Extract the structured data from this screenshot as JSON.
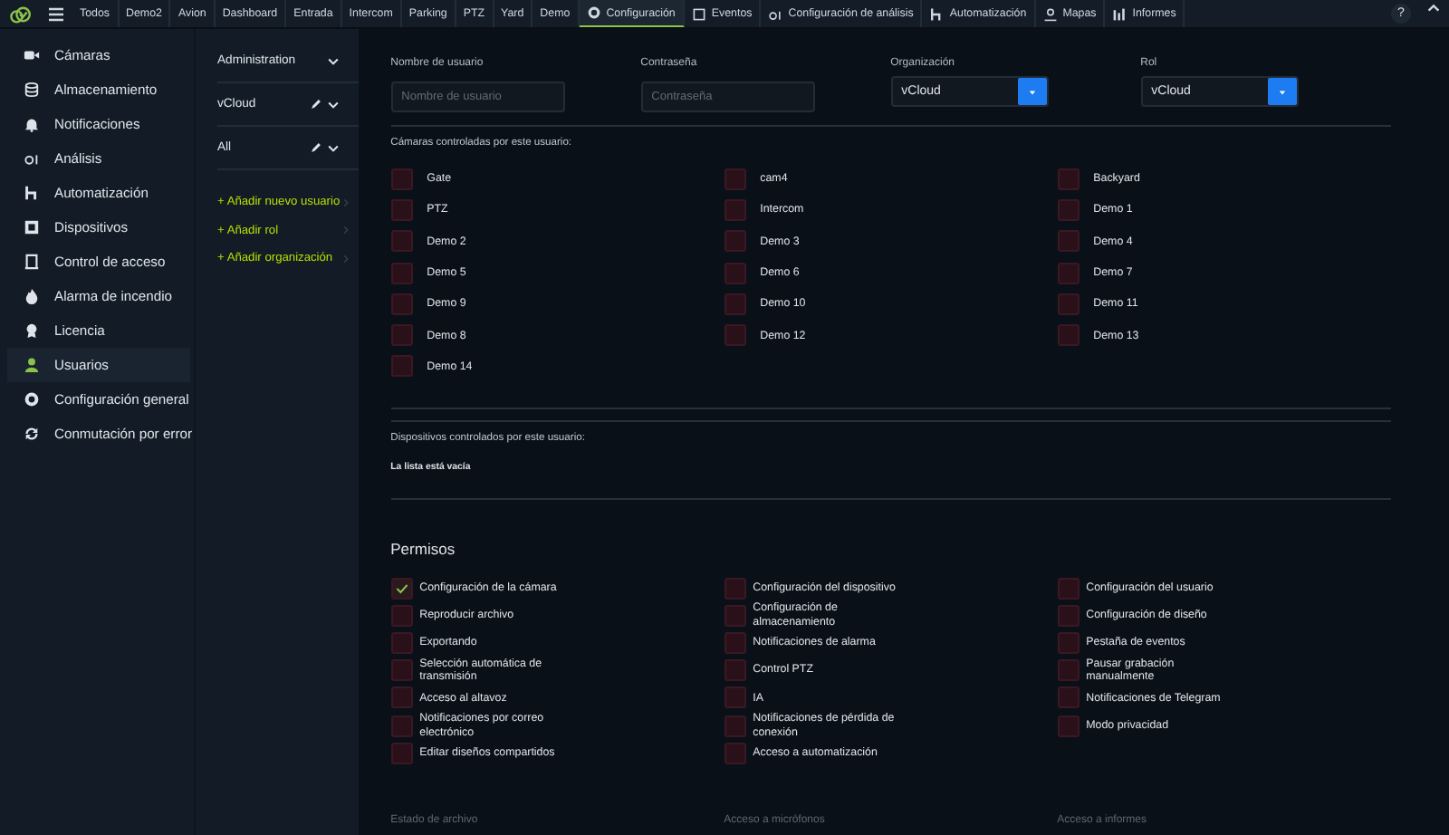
{
  "topbar": {
    "tabs": [
      {
        "label": "Todos",
        "selected": false
      },
      {
        "label": "Demo2",
        "selected": false
      },
      {
        "label": "Avion",
        "selected": false
      },
      {
        "label": "Dashboard",
        "selected": false
      },
      {
        "label": "Entrada",
        "selected": false
      },
      {
        "label": "Intercom",
        "selected": false
      },
      {
        "label": "Parking",
        "selected": false
      },
      {
        "label": "PTZ",
        "selected": false
      },
      {
        "label": "Yard",
        "selected": false
      },
      {
        "label": "Demo",
        "selected": false
      },
      {
        "label": "Configuración",
        "selected": true
      },
      {
        "label": "Eventos",
        "selected": false
      },
      {
        "label": "Configuración de análisis",
        "selected": false
      },
      {
        "label": "Automatización",
        "selected": false
      },
      {
        "label": "Mapas",
        "selected": false
      },
      {
        "label": "Informes",
        "selected": false
      }
    ],
    "help": "?"
  },
  "sidebar": {
    "items": [
      {
        "label": "Cámaras",
        "selected": false
      },
      {
        "label": "Almacenamiento",
        "selected": false
      },
      {
        "label": "Notificaciones",
        "selected": false
      },
      {
        "label": "Análisis",
        "selected": false
      },
      {
        "label": "Automatización",
        "selected": false
      },
      {
        "label": "Dispositivos",
        "selected": false
      },
      {
        "label": "Control de acceso",
        "selected": false
      },
      {
        "label": "Alarma de incendio",
        "selected": false
      },
      {
        "label": "Licencia",
        "selected": false
      },
      {
        "label": "Usuarios",
        "selected": true
      },
      {
        "label": "Configuración general",
        "selected": false
      },
      {
        "label": "Conmutación por error",
        "selected": false
      }
    ]
  },
  "tree": {
    "selectors": [
      {
        "label": "Administration",
        "editable": false
      },
      {
        "label": "vCloud",
        "editable": true
      },
      {
        "label": "All",
        "editable": true
      }
    ],
    "links": [
      "+ Añadir nuevo usuario",
      "+ Añadir rol",
      "+ Añadir organización"
    ]
  },
  "form": {
    "fields": [
      {
        "label": "Nombre de usuario",
        "kind": "text",
        "placeholder": "Nombre de usuario"
      },
      {
        "label": "Contraseña",
        "kind": "text",
        "placeholder": "Contraseña"
      },
      {
        "label": "Organización",
        "kind": "select",
        "value": "vCloud"
      },
      {
        "label": "Rol",
        "kind": "select",
        "value": "vCloud"
      }
    ],
    "cameras_label": "Cámaras controladas por este usuario:",
    "cameras": [
      {
        "label": "Gate",
        "checked": false
      },
      {
        "label": "cam4",
        "checked": false
      },
      {
        "label": "Backyard",
        "checked": false
      },
      {
        "label": "PTZ",
        "checked": false
      },
      {
        "label": "Intercom",
        "checked": false
      },
      {
        "label": "Demo 1",
        "checked": false
      },
      {
        "label": "Demo 2",
        "checked": false
      },
      {
        "label": "Demo 3",
        "checked": false
      },
      {
        "label": "Demo 4",
        "checked": false
      },
      {
        "label": "Demo 5",
        "checked": false
      },
      {
        "label": "Demo 6",
        "checked": false
      },
      {
        "label": "Demo 7",
        "checked": false
      },
      {
        "label": "Demo 9",
        "checked": false
      },
      {
        "label": "Demo 10",
        "checked": false
      },
      {
        "label": "Demo 11",
        "checked": false
      },
      {
        "label": "Demo 8",
        "checked": false
      },
      {
        "label": "Demo 12",
        "checked": false
      },
      {
        "label": "Demo 13",
        "checked": false
      },
      {
        "label": "Demo 14",
        "checked": false
      }
    ],
    "devices_label": "Dispositivos controlados por este usuario:",
    "devices_empty": "La lista está vacía",
    "permissions_title": "Permisos",
    "permission_columns": [
      [
        {
          "label": "Configuración de la cámara",
          "checked": true
        },
        {
          "label": "Reproducir archivo",
          "checked": false
        },
        {
          "label": "Exportando",
          "checked": false
        },
        {
          "label": "Selección automática de transmisión",
          "checked": false
        },
        {
          "label": "Acceso al altavoz",
          "checked": false
        },
        {
          "label": "Notificaciones por correo electrónico",
          "checked": false
        },
        {
          "label": "Editar diseños compartidos",
          "checked": false
        }
      ],
      [
        {
          "label": "Configuración del dispositivo",
          "checked": false
        },
        {
          "label": "Configuración de almacenamiento",
          "checked": false
        },
        {
          "label": "Notificaciones de alarma",
          "checked": false
        },
        {
          "label": "Control PTZ",
          "checked": false
        },
        {
          "label": "IA",
          "checked": false
        },
        {
          "label": "Notificaciones de pérdida de conexión",
          "checked": false
        },
        {
          "label": "Acceso a automatización",
          "checked": false
        }
      ],
      [
        {
          "label": "Configuración del usuario",
          "checked": false
        },
        {
          "label": "Configuración de diseño",
          "checked": false
        },
        {
          "label": "Pestaña de eventos",
          "checked": false
        },
        {
          "label": "Pausar grabación manualmente",
          "checked": false
        },
        {
          "label": "Notificaciones de Telegram",
          "checked": false
        },
        {
          "label": "Modo privacidad",
          "checked": false
        }
      ]
    ],
    "bottom_labels": [
      "Estado de archivo",
      "Acceso a micrófonos",
      "Acceso a informes"
    ]
  }
}
